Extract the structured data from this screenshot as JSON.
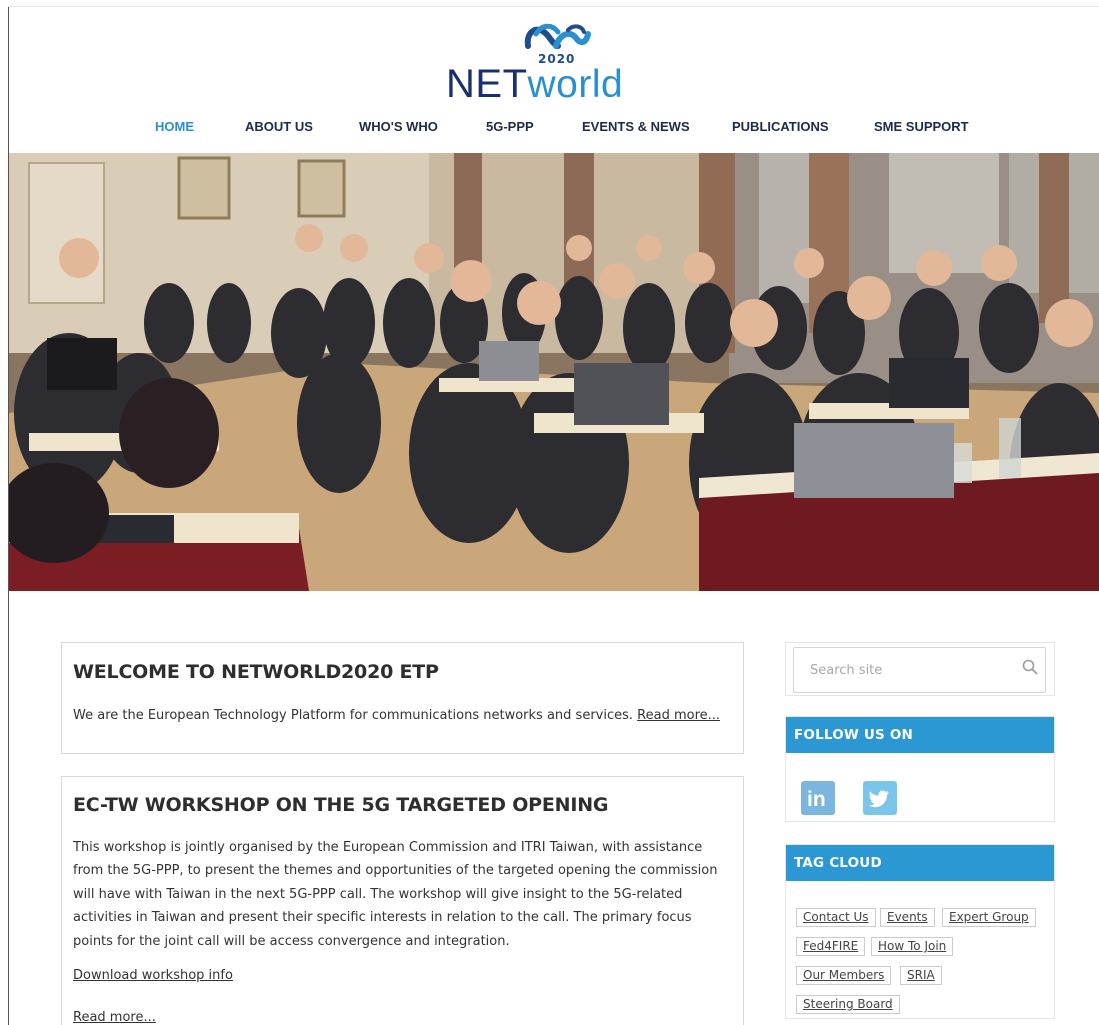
{
  "brand": {
    "year": "2020",
    "name_part1": "NET",
    "name_part2": "world"
  },
  "nav": [
    {
      "label": "HOME",
      "active": true
    },
    {
      "label": "ABOUT US",
      "active": false
    },
    {
      "label": "WHO'S WHO",
      "active": false
    },
    {
      "label": "5G-PPP",
      "active": false
    },
    {
      "label": "EVENTS & NEWS",
      "active": false
    },
    {
      "label": "PUBLICATIONS",
      "active": false
    },
    {
      "label": "SME SUPPORT",
      "active": false
    }
  ],
  "welcome": {
    "title": "WELCOME TO NETWORLD2020 ETP",
    "text": "We are the European Technology Platform for communications networks and services. ",
    "read_more": "Read more..."
  },
  "workshop": {
    "title": "EC-TW WORKSHOP ON THE 5G TARGETED OPENING",
    "text": "This workshop is jointly organised by the European Commission and ITRI Taiwan, with assistance from the 5G-PPP, to present the themes and opportunities of the targeted opening the commission will have with Taiwan in the next 5G-PPP call. The workshop will give insight to the 5G-related activities in Taiwan and present their specific interests in relation to the call. The primary focus points for the joint call will be access convergence and integration.",
    "download": "Download workshop info",
    "read_more": "Read more..."
  },
  "search": {
    "placeholder": "Search site"
  },
  "follow": {
    "title": "FOLLOW US ON",
    "linkedin": "in"
  },
  "tag_cloud": {
    "title": "TAG CLOUD",
    "tags": [
      "Contact Us",
      "Events",
      "Expert Group",
      "Fed4FIRE",
      "How To Join",
      "Our Members",
      "SRIA",
      "Steering Board"
    ]
  },
  "colors": {
    "accent": "#2b98d3",
    "nav_text": "#1c2b48",
    "logo_dark": "#1a2f6e",
    "logo_light": "#2a8fcf"
  },
  "icons": [
    "networld-logo-icon",
    "search-icon",
    "linkedin-icon",
    "twitter-icon"
  ]
}
